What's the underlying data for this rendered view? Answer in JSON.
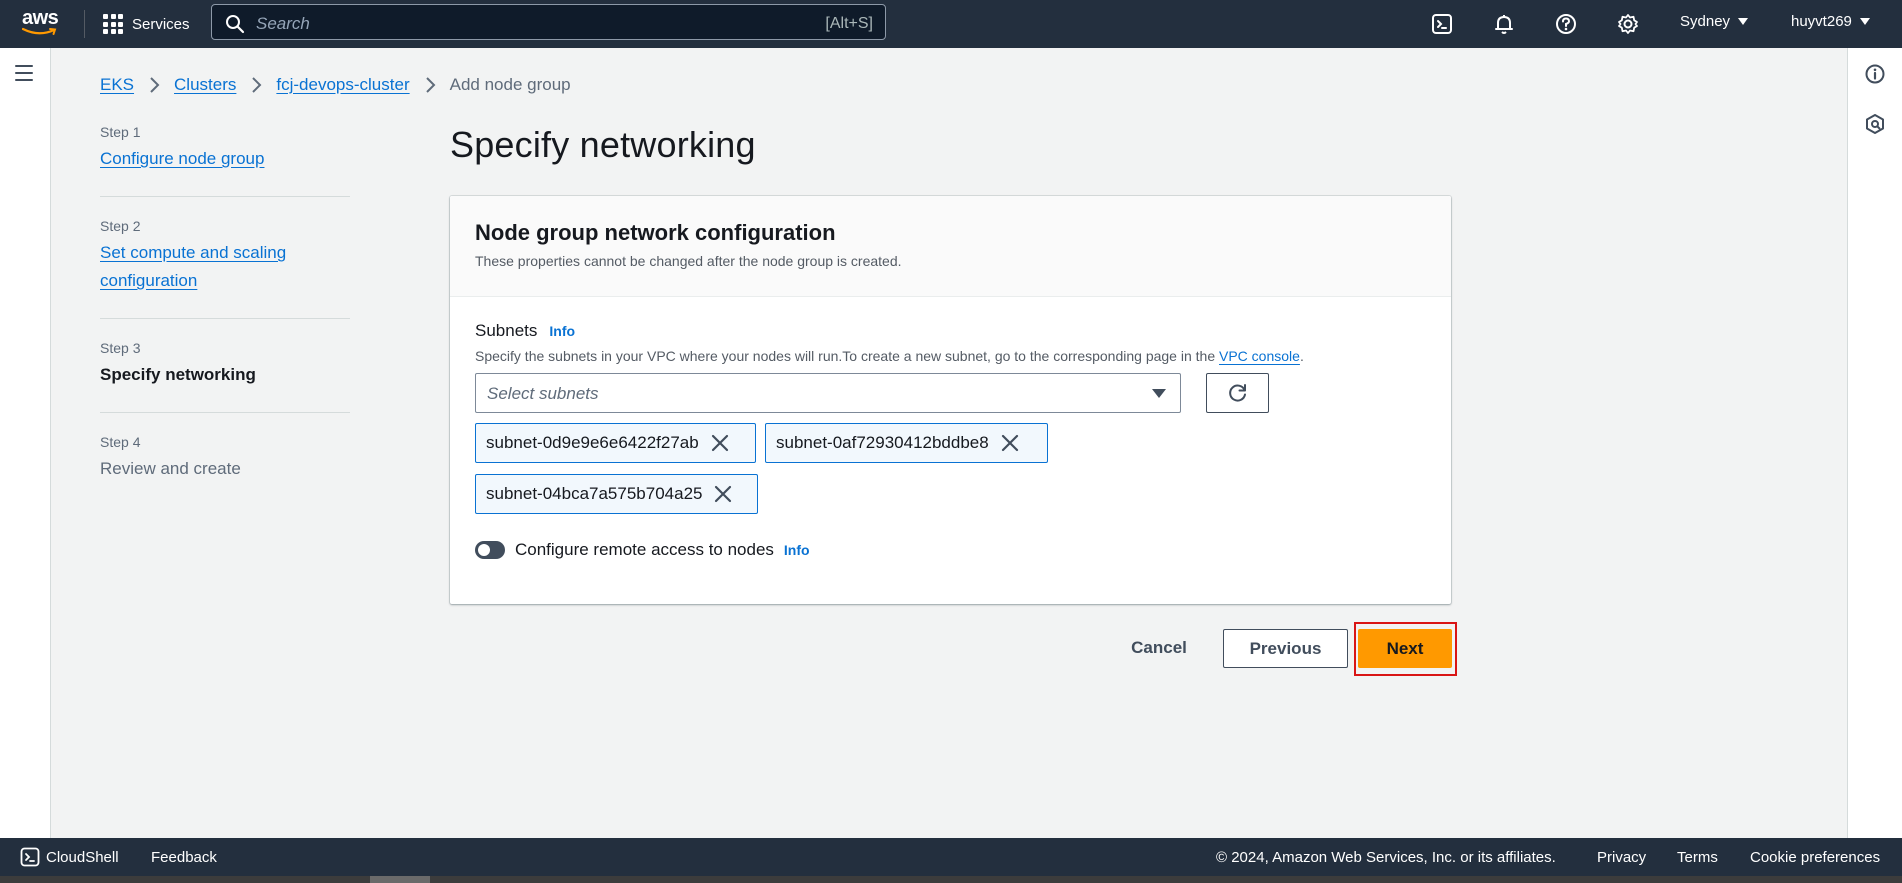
{
  "topnav": {
    "logo_text": "aws",
    "services_label": "Services",
    "search_placeholder": "Search",
    "search_shortcut": "[Alt+S]",
    "region": "Sydney",
    "account": "huyvt269",
    "icons": [
      "cloudshell-icon",
      "bell-icon",
      "help-icon",
      "settings-icon"
    ]
  },
  "breadcrumb": {
    "items": [
      "EKS",
      "Clusters",
      "fcj-devops-cluster"
    ],
    "current": "Add node group"
  },
  "steps": [
    {
      "num": "Step 1",
      "label": "Configure node group",
      "state": "link"
    },
    {
      "num": "Step 2",
      "label": "Set compute and scaling configuration",
      "label_line1": "Set compute and scaling",
      "label_line2": "configuration",
      "state": "link"
    },
    {
      "num": "Step 3",
      "label": "Specify networking",
      "state": "current"
    },
    {
      "num": "Step 4",
      "label": "Review and create",
      "state": "disabled"
    }
  ],
  "page_title": "Specify networking",
  "container": {
    "title": "Node group network configuration",
    "description": "These properties cannot be changed after the node group is created.",
    "subnets": {
      "label": "Subnets",
      "info": "Info",
      "description_prefix": "Specify the subnets in your VPC where your nodes will run.To create a new subnet, go to the corresponding page in the ",
      "description_link": "VPC console",
      "description_suffix": ".",
      "placeholder": "Select subnets",
      "selected": [
        "subnet-0d9e9e6e6422f27ab",
        "subnet-0af72930412bddbe8",
        "subnet-04bca7a575b704a25"
      ]
    },
    "remote_access": {
      "label": "Configure remote access to nodes",
      "info": "Info",
      "enabled": false
    }
  },
  "actions": {
    "cancel": "Cancel",
    "previous": "Previous",
    "next": "Next"
  },
  "footer": {
    "cloudshell": "CloudShell",
    "feedback": "Feedback",
    "copyright": "© 2024, Amazon Web Services, Inc. or its affiliates.",
    "privacy": "Privacy",
    "terms": "Terms",
    "cookie": "Cookie preferences"
  },
  "colors": {
    "nav_bg": "#232f3e",
    "link": "#0972d3",
    "primary_button": "#ff9900",
    "highlight_border": "#d91515"
  }
}
